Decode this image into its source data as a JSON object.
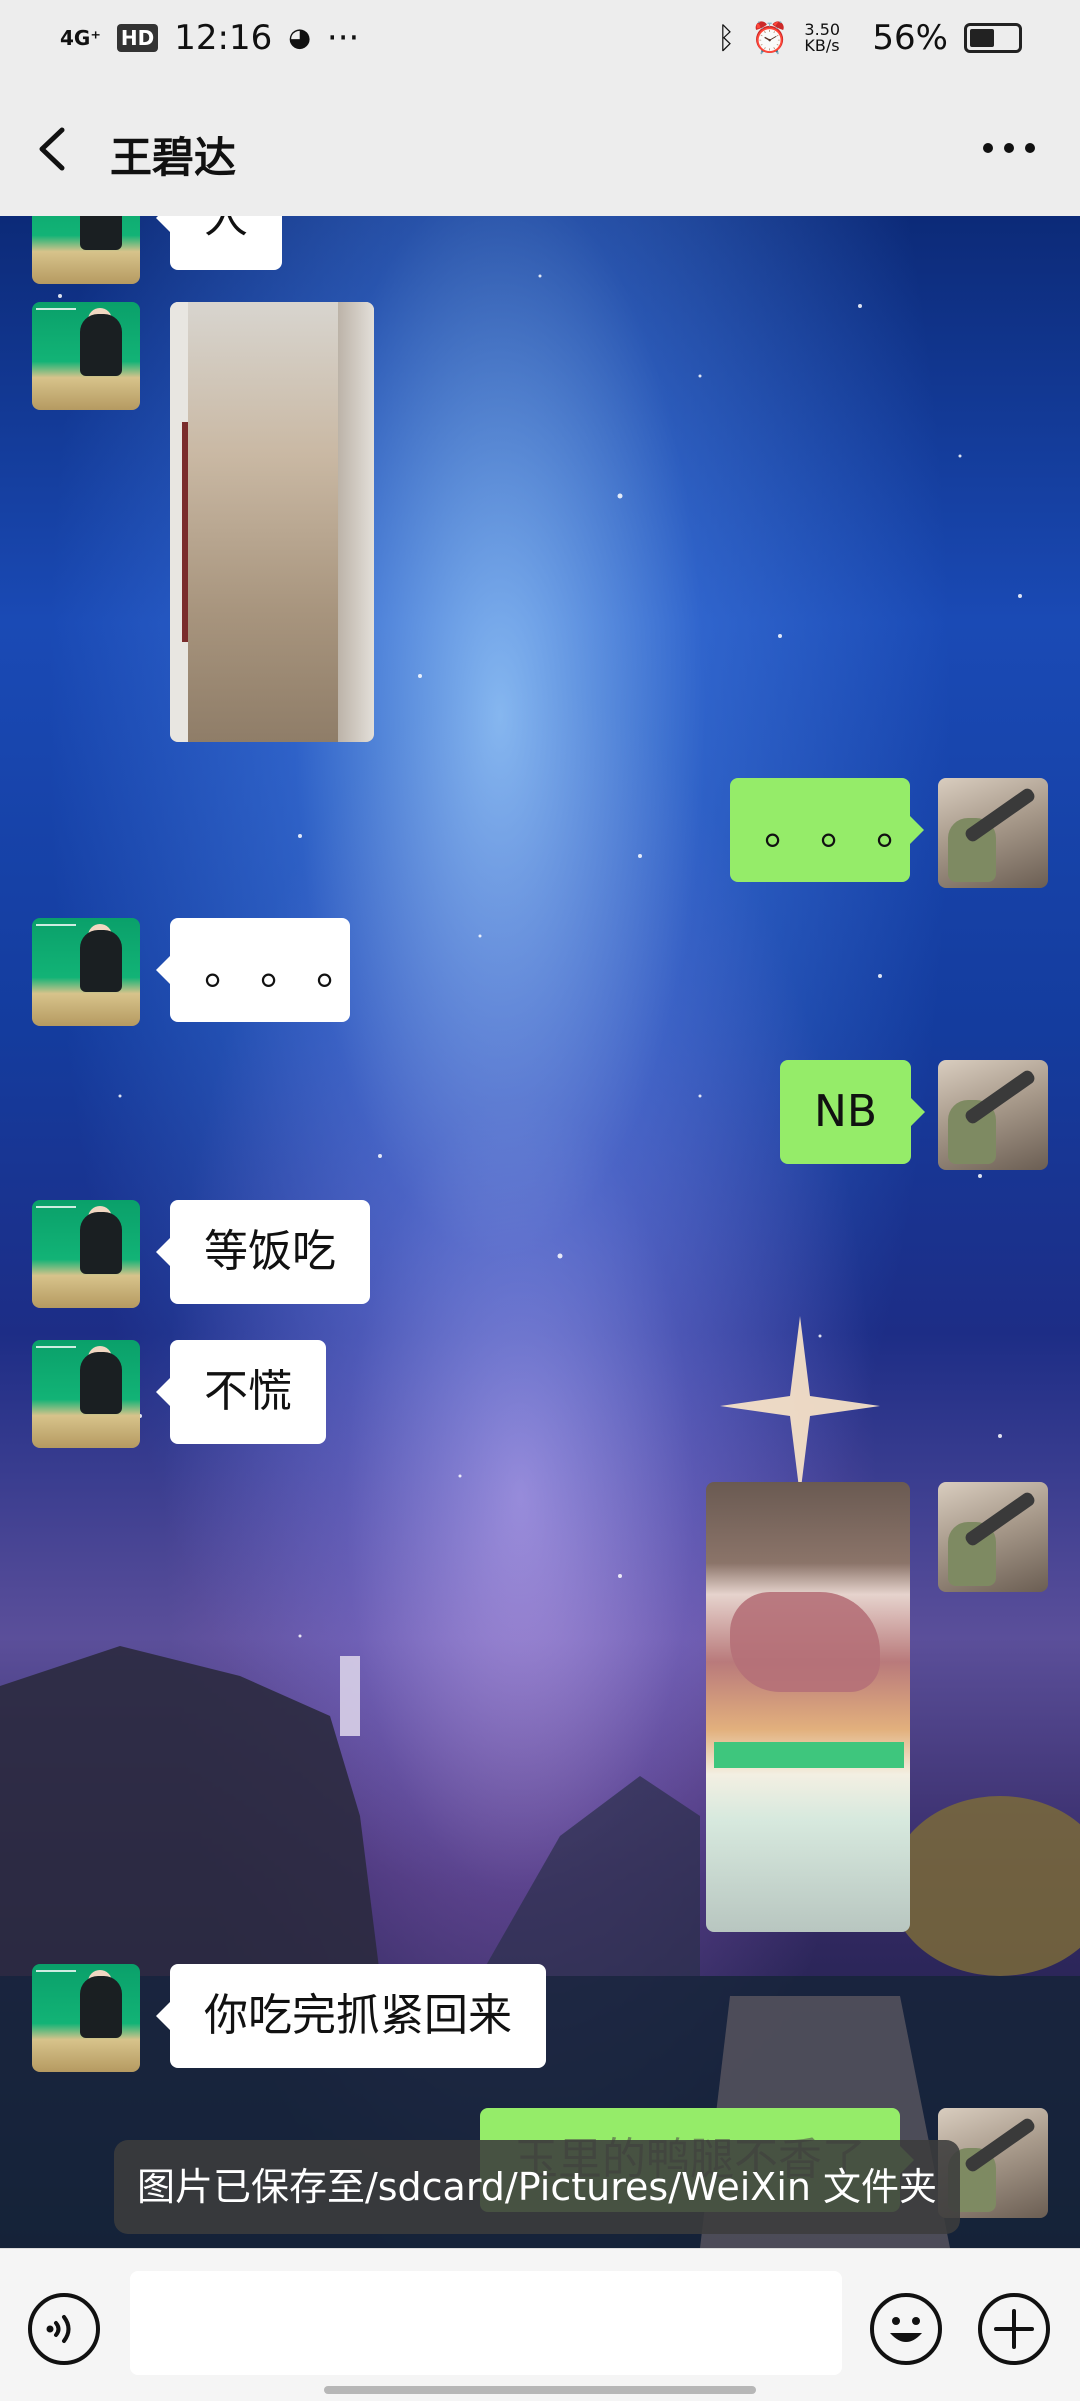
{
  "status_bar": {
    "network": "4G⁺",
    "hd": "HD",
    "time": "12:16",
    "net_speed": "3.50 KB/s",
    "battery": "56%"
  },
  "header": {
    "title": "王碧达",
    "back_icon": "back-chevron-icon",
    "more_icon": "more-dots-icon"
  },
  "chat": {
    "partial_top_text": "人",
    "msg_dots_right": "。。。",
    "msg_dots_left": "。。。",
    "msg_nb": "NB",
    "msg_deng": "等饭吃",
    "msg_buhuang": "不慌",
    "msg_last_left": "你吃完抓紧回来",
    "msg_last_right_partial": "玉里的鸭腿不香了"
  },
  "toast": "图片已保存至/sdcard/Pictures/WeiXin 文件夹",
  "input_bar": {
    "voice_icon": "voice-input-icon",
    "emoji_icon": "emoji-icon",
    "plus_icon": "plus-icon"
  },
  "colors": {
    "my_bubble": "#95ec69",
    "their_bubble": "#ffffff",
    "bar_bg": "#ededed"
  }
}
